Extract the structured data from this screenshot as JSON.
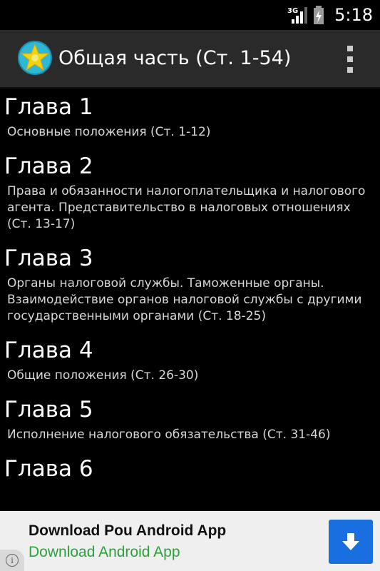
{
  "status_bar": {
    "network_label": "3G",
    "time": "5:18"
  },
  "action_bar": {
    "title": "Общая часть (Ст. 1-54)",
    "app_icon": "star-emblem-icon",
    "menu_icon": "overflow-menu-icon"
  },
  "chapters": [
    {
      "title": "Глава 1",
      "desc": "Основные положения (Ст. 1-12)"
    },
    {
      "title": "Глава 2",
      "desc": "Права и обязанности налогоплательщика и налогового агента. Представительство в налоговых отношениях (Ст. 13-17)"
    },
    {
      "title": "Глава 3",
      "desc": "Органы налоговой службы. Таможенные органы. Взаимодействие органов налоговой службы с другими государственными органами (Ст. 18-25)"
    },
    {
      "title": "Глава 4",
      "desc": "Общие положения (Ст. 26-30)"
    },
    {
      "title": "Глава 5",
      "desc": "Исполнение налогового обязательства (Ст. 31-46)"
    },
    {
      "title": "Глава 6",
      "desc": ""
    }
  ],
  "ad": {
    "title": "Download Pou Android App",
    "subtitle": "Download Android App",
    "download_icon": "download-arrow-icon",
    "info_icon": "info-icon",
    "info_glyph": "i"
  }
}
